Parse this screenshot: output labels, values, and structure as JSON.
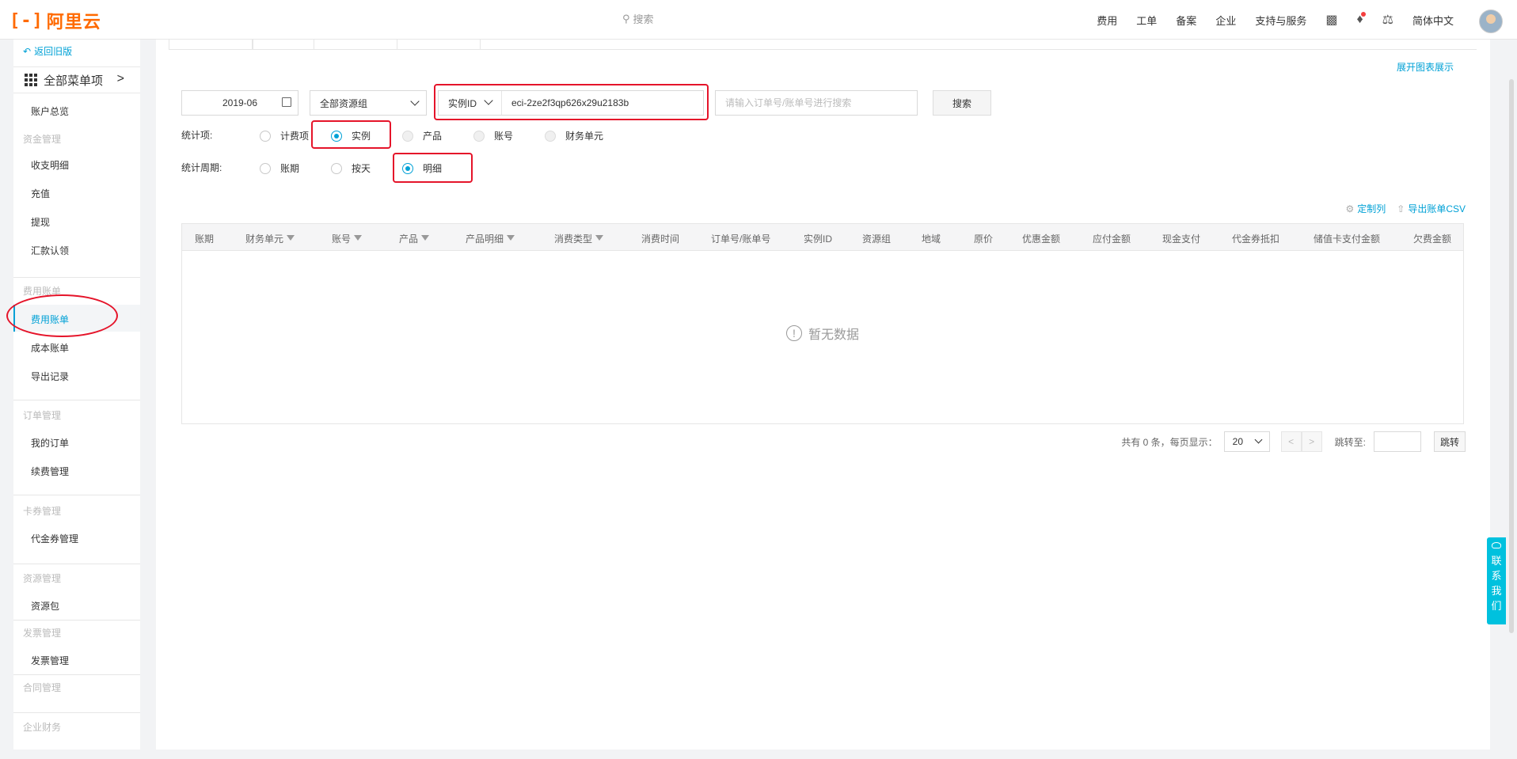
{
  "header": {
    "logo_text": "阿里云",
    "search_placeholder": "搜索",
    "nav": [
      "费用",
      "工单",
      "备案",
      "企业",
      "支持与服务"
    ],
    "language": "简体中文",
    "icons": [
      "terminal-icon",
      "bell-icon",
      "cart-icon"
    ]
  },
  "sidebar": {
    "back": "返回旧版",
    "all_menu": "全部菜单项",
    "items": [
      {
        "label": "账户总览",
        "type": "item"
      },
      {
        "label": "资金管理",
        "type": "group"
      },
      {
        "label": "收支明细",
        "type": "item"
      },
      {
        "label": "充值",
        "type": "item"
      },
      {
        "label": "提现",
        "type": "item"
      },
      {
        "label": "汇款认领",
        "type": "item"
      },
      {
        "label": "费用账单",
        "type": "group"
      },
      {
        "label": "费用账单",
        "type": "item",
        "active": true
      },
      {
        "label": "成本账单",
        "type": "item"
      },
      {
        "label": "导出记录",
        "type": "item"
      },
      {
        "label": "订单管理",
        "type": "group"
      },
      {
        "label": "我的订单",
        "type": "item"
      },
      {
        "label": "续费管理",
        "type": "item"
      },
      {
        "label": "卡券管理",
        "type": "group"
      },
      {
        "label": "代金券管理",
        "type": "item"
      },
      {
        "label": "资源管理",
        "type": "group"
      },
      {
        "label": "资源包",
        "type": "item"
      },
      {
        "label": "发票管理",
        "type": "group"
      },
      {
        "label": "发票管理",
        "type": "item"
      },
      {
        "label": "合同管理",
        "type": "group"
      },
      {
        "label": "企业财务",
        "type": "group"
      }
    ]
  },
  "main": {
    "expand_chart": "展开图表展示",
    "filters": {
      "date": "2019-06",
      "resource_group": "全部资源组",
      "id_type": "实例ID",
      "instance_id": "eci-2ze2f3qp626x29u2183b",
      "order_placeholder": "请输入订单号/账单号进行搜索",
      "search_button": "搜索"
    },
    "stat_item": {
      "label": "统计项:",
      "options": [
        {
          "label": "计费项",
          "state": "off"
        },
        {
          "label": "实例",
          "state": "on"
        },
        {
          "label": "产品",
          "state": "disabled"
        },
        {
          "label": "账号",
          "state": "disabled"
        },
        {
          "label": "财务单元",
          "state": "disabled"
        }
      ]
    },
    "stat_period": {
      "label": "统计周期:",
      "options": [
        {
          "label": "账期",
          "state": "off"
        },
        {
          "label": "按天",
          "state": "off"
        },
        {
          "label": "明细",
          "state": "on"
        }
      ]
    },
    "tools": {
      "customize": "定制列",
      "export": "导出账单CSV"
    },
    "table": {
      "columns": [
        {
          "label": "账期",
          "filter": false
        },
        {
          "label": "财务单元",
          "filter": true
        },
        {
          "label": "账号",
          "filter": true
        },
        {
          "label": "产品",
          "filter": true
        },
        {
          "label": "产品明细",
          "filter": true
        },
        {
          "label": "消费类型",
          "filter": true
        },
        {
          "label": "消费时间",
          "filter": false
        },
        {
          "label": "订单号/账单号",
          "filter": false
        },
        {
          "label": "实例ID",
          "filter": false
        },
        {
          "label": "资源组",
          "filter": false
        },
        {
          "label": "地域",
          "filter": false
        },
        {
          "label": "原价",
          "filter": false
        },
        {
          "label": "优惠金额",
          "filter": false
        },
        {
          "label": "应付金额",
          "filter": false
        },
        {
          "label": "现金支付",
          "filter": false
        },
        {
          "label": "代金券抵扣",
          "filter": false
        },
        {
          "label": "储值卡支付金额",
          "filter": false
        },
        {
          "label": "欠费金额",
          "filter": false
        }
      ],
      "empty_text": "暂无数据"
    },
    "pagination": {
      "total_text": "共有 0 条，每页显示：",
      "page_size": "20",
      "prev": "<",
      "next": ">",
      "jump_label": "跳转至:",
      "jump_button": "跳转"
    }
  },
  "contact": [
    "联",
    "系",
    "我",
    "们"
  ],
  "colors": {
    "accent": "#00a1d6",
    "brand": "#ff6a00",
    "highlight": "#e5142a"
  }
}
